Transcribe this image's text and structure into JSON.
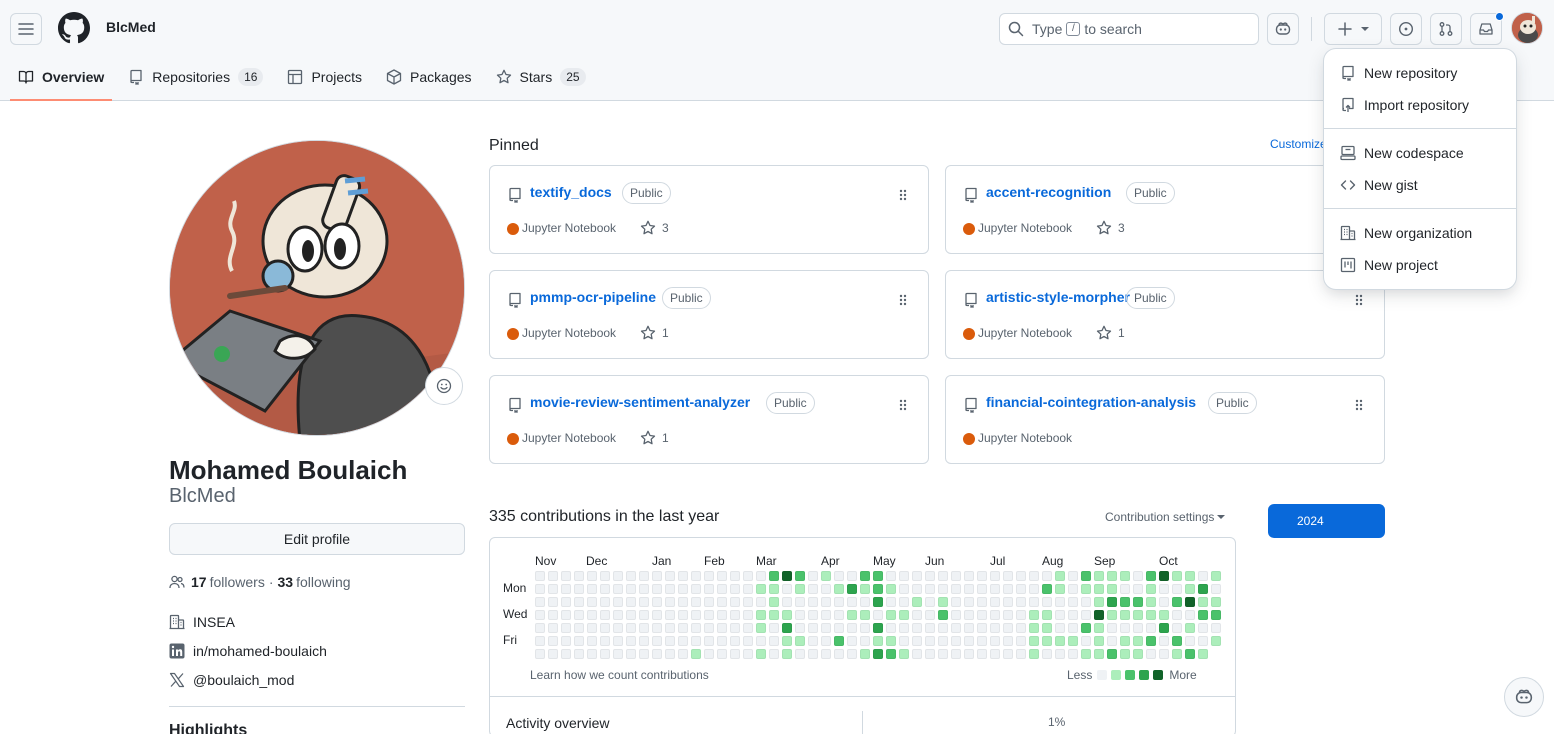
{
  "header": {
    "context": "BlcMed",
    "search_prefix": "Type",
    "search_key": "/",
    "search_suffix": "to search",
    "icons": [
      "hamburger-icon",
      "github-logo",
      "search-icon",
      "copilot-icon",
      "plus-icon",
      "triangle-down-icon",
      "issue-icon",
      "pull-request-icon",
      "inbox-icon"
    ]
  },
  "tabs": [
    {
      "label": "Overview",
      "icon": "book-icon",
      "active": true
    },
    {
      "label": "Repositories",
      "icon": "repo-icon",
      "count": "16"
    },
    {
      "label": "Projects",
      "icon": "table-icon"
    },
    {
      "label": "Packages",
      "icon": "package-icon"
    },
    {
      "label": "Stars",
      "icon": "star-icon",
      "count": "25"
    }
  ],
  "profile": {
    "fullname": "Mohamed Boulaich",
    "username": "BlcMed",
    "edit_label": "Edit profile",
    "followers_count": "17",
    "followers_label": "followers",
    "separator": "·",
    "following_count": "33",
    "following_label": "following",
    "organization": "INSEA",
    "linkedin": "in/mohamed-boulaich",
    "twitter": "@boulaich_mod",
    "highlights": "Highlights"
  },
  "pinned": {
    "title": "Pinned",
    "customize": "Customize your pins",
    "repos": [
      {
        "name": "textify_docs",
        "visibility": "Public",
        "language": "Jupyter Notebook",
        "stars": "3"
      },
      {
        "name": "accent-recognition",
        "visibility": "Public",
        "language": "Jupyter Notebook",
        "stars": "3"
      },
      {
        "name": "pmmp-ocr-pipeline",
        "visibility": "Public",
        "language": "Jupyter Notebook",
        "stars": "1"
      },
      {
        "name": "artistic-style-morpher",
        "visibility": "Public",
        "language": "Jupyter Notebook",
        "stars": "1"
      },
      {
        "name": "movie-review-sentiment-analyzer",
        "visibility": "Public",
        "language": "Jupyter Notebook",
        "stars": "1"
      },
      {
        "name": "financial-cointegration-analysis",
        "visibility": "Public",
        "language": "Jupyter Notebook",
        "stars": ""
      }
    ],
    "language_color": "#da5b0b"
  },
  "contributions": {
    "title": "335 contributions in the last year",
    "settings": "Contribution settings",
    "year": "2024",
    "months": [
      "Nov",
      "Dec",
      "Jan",
      "Feb",
      "Mar",
      "Apr",
      "May",
      "Jun",
      "Jul",
      "Aug",
      "Sep",
      "Oct"
    ],
    "days": [
      "Mon",
      "Wed",
      "Fri"
    ],
    "learn": "Learn how we count contributions",
    "less": "Less",
    "more": "More",
    "level_colors": [
      "#eff2f5",
      "#aceebb",
      "#4ac26b",
      "#2da44e",
      "#116329"
    ],
    "activity_title": "Activity overview",
    "activity_pct": "1%"
  },
  "dropdown": {
    "items": [
      {
        "label": "New repository",
        "icon": "repo-icon"
      },
      {
        "label": "Import repository",
        "icon": "repo-push-icon"
      },
      {
        "label": "New codespace",
        "icon": "codespaces-icon"
      },
      {
        "label": "New gist",
        "icon": "code-icon"
      },
      {
        "label": "New organization",
        "icon": "organization-icon"
      },
      {
        "label": "New project",
        "icon": "project-icon"
      }
    ]
  },
  "colors": {
    "accent": "#0969da",
    "tab_underline": "#fd8c73",
    "avatar_bg": "#c0614a"
  }
}
